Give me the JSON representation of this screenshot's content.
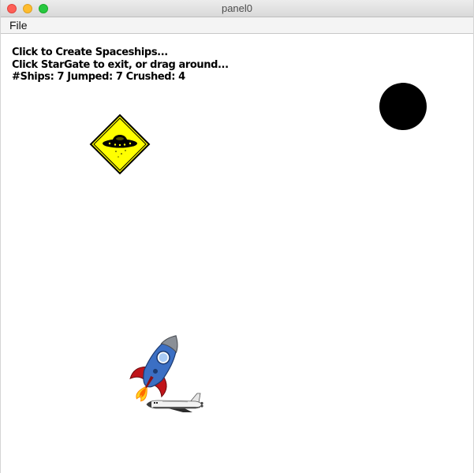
{
  "window": {
    "title": "panel0"
  },
  "menu": {
    "file_label": "File"
  },
  "status": {
    "line1": "Click to Create Spaceships...",
    "line2": "Click StarGate to exit, or drag around...",
    "line3": "#Ships: 7 Jumped: 7 Crushed: 4"
  },
  "colors": {
    "stargate": "#000000",
    "sign_fill": "#ffff00",
    "rocket_body": "#3b6fc4",
    "rocket_fins": "#c0141a",
    "flame": "#ffd21f"
  },
  "icons": {
    "stargate": "stargate-portal",
    "ufo_sign": "ufo-warning-sign",
    "rocket": "rocket-ship",
    "shuttle": "space-shuttle"
  }
}
